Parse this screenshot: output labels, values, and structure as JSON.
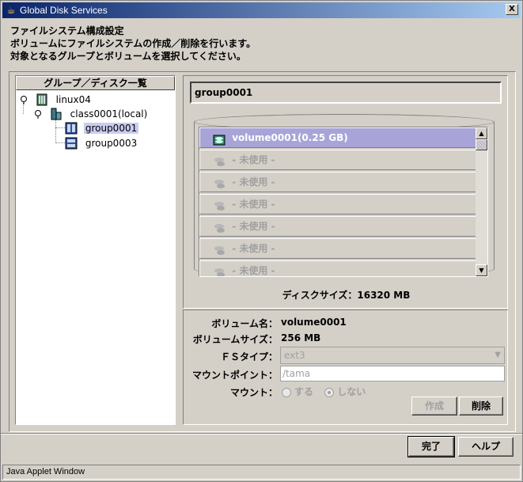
{
  "window": {
    "title": "Global Disk Services",
    "close_glyph": "X"
  },
  "description": {
    "line1": "ファイルシステム構成設定",
    "line2": "ボリュームにファイルシステムの作成／削除を行います。",
    "line3": "対象となるグループとボリュームを選択してください。"
  },
  "tree": {
    "header": "グループ／ディスク一覧",
    "nodes": [
      {
        "label": "linux04",
        "icon": "server-icon"
      },
      {
        "label": "class0001(local)",
        "icon": "class-icon"
      },
      {
        "label": "group0001",
        "icon": "group-icon",
        "selected": true
      },
      {
        "label": "group0003",
        "icon": "group-icon"
      }
    ]
  },
  "group_panel": {
    "group_name": "group0001",
    "volumes": [
      {
        "label": "volume0001(0.25 GB)",
        "state": "active"
      },
      {
        "label": "- 未使用 -",
        "state": "unused"
      },
      {
        "label": "- 未使用 -",
        "state": "unused"
      },
      {
        "label": "- 未使用 -",
        "state": "unused"
      },
      {
        "label": "- 未使用 -",
        "state": "unused"
      },
      {
        "label": "- 未使用 -",
        "state": "unused"
      },
      {
        "label": "- 未使用 -",
        "state": "unused"
      }
    ],
    "disk_size": "ディスクサイズ：16320 MB"
  },
  "properties": {
    "volume_name_label": "ボリューム名：",
    "volume_name_value": "volume0001",
    "volume_size_label": "ボリュームサイズ：",
    "volume_size_value": "256 MB",
    "fs_type_label": "ＦＳタイプ：",
    "fs_type_value": "ext3",
    "mount_point_label": "マウントポイント：",
    "mount_point_value": "/tama",
    "mount_label": "マウント：",
    "mount_options": [
      "する",
      "しない"
    ],
    "mount_selected": "しない",
    "create_button": "作成",
    "delete_button": "削除"
  },
  "footer": {
    "finish_button": "完了",
    "help_button": "ヘルプ",
    "status_text": "Java Applet Window"
  },
  "colors": {
    "selection": "#a8a4d8",
    "title_start": "#0a246a",
    "title_end": "#a6caf0"
  }
}
